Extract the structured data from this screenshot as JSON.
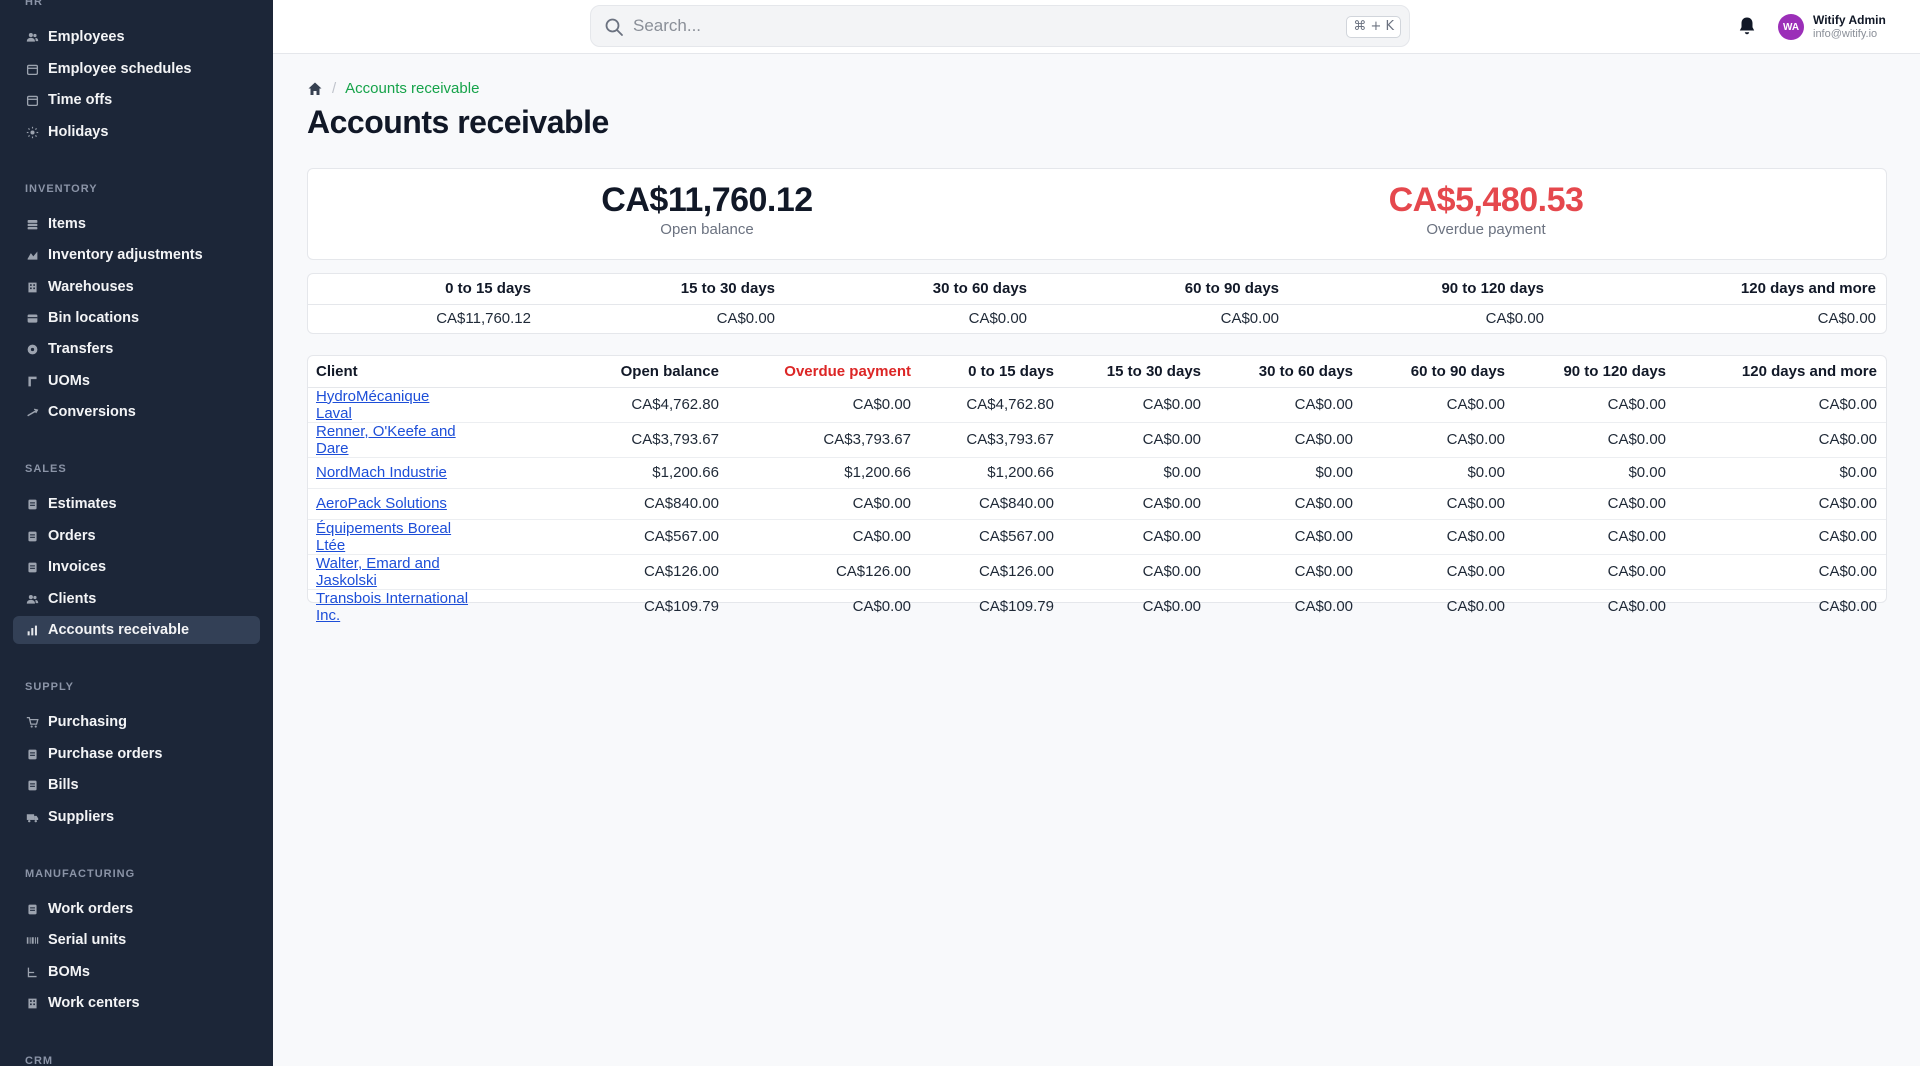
{
  "sidebar": {
    "sections": [
      {
        "title": "HR",
        "items": [
          {
            "label": "Employees",
            "icon": "people-icon"
          },
          {
            "label": "Employee schedules",
            "icon": "calendar-icon"
          },
          {
            "label": "Time offs",
            "icon": "calendar-icon"
          },
          {
            "label": "Holidays",
            "icon": "sun-icon"
          }
        ]
      },
      {
        "title": "INVENTORY",
        "items": [
          {
            "label": "Items",
            "icon": "stack-icon"
          },
          {
            "label": "Inventory adjustments",
            "icon": "scale-icon"
          },
          {
            "label": "Warehouses",
            "icon": "building-icon"
          },
          {
            "label": "Bin locations",
            "icon": "box-icon"
          },
          {
            "label": "Transfers",
            "icon": "transfer-icon"
          },
          {
            "label": "UOMs",
            "icon": "ruler-icon"
          },
          {
            "label": "Conversions",
            "icon": "conversion-icon"
          }
        ]
      },
      {
        "title": "SALES",
        "items": [
          {
            "label": "Estimates",
            "icon": "document-icon"
          },
          {
            "label": "Orders",
            "icon": "document-icon"
          },
          {
            "label": "Invoices",
            "icon": "document-icon"
          },
          {
            "label": "Clients",
            "icon": "people-icon"
          },
          {
            "label": "Accounts receivable",
            "icon": "bar-chart-icon"
          }
        ]
      },
      {
        "title": "SUPPLY",
        "items": [
          {
            "label": "Purchasing",
            "icon": "cart-icon"
          },
          {
            "label": "Purchase orders",
            "icon": "document-icon"
          },
          {
            "label": "Bills",
            "icon": "document-icon"
          },
          {
            "label": "Suppliers",
            "icon": "truck-icon"
          }
        ]
      },
      {
        "title": "MANUFACTURING",
        "items": [
          {
            "label": "Work orders",
            "icon": "document-icon"
          },
          {
            "label": "Serial units",
            "icon": "barcode-icon"
          },
          {
            "label": "BOMs",
            "icon": "tree-icon"
          },
          {
            "label": "Work centers",
            "icon": "building-icon"
          }
        ]
      },
      {
        "title": "CRM",
        "items": []
      }
    ],
    "active_item": "Accounts receivable"
  },
  "topbar": {
    "search_placeholder": "Search...",
    "shortcut": "⌘ + K",
    "user": {
      "initials": "WA",
      "name": "Witify Admin",
      "email": "info@witify.io",
      "avatar_color": "#9b2fb8"
    }
  },
  "breadcrumb": {
    "current": "Accounts receivable"
  },
  "page_title": "Accounts receivable",
  "summary": {
    "open_balance": {
      "value": "CA$11,760.12",
      "label": "Open balance"
    },
    "overdue_payment": {
      "value": "CA$5,480.53",
      "label": "Overdue payment",
      "color": "#e5484d"
    }
  },
  "aging": {
    "headers": [
      "0 to 15 days",
      "15 to 30 days",
      "30 to 60 days",
      "60 to 90 days",
      "90 to 120 days",
      "120 days and more"
    ],
    "values": [
      "CA$11,760.12",
      "CA$0.00",
      "CA$0.00",
      "CA$0.00",
      "CA$0.00",
      "CA$0.00"
    ]
  },
  "clients_table": {
    "headers": [
      "Client",
      "Open balance",
      "Overdue payment",
      "0 to 15 days",
      "15 to 30 days",
      "30 to 60 days",
      "60 to 90 days",
      "90 to 120 days",
      "120 days and more"
    ],
    "rows": [
      [
        "HydroMécanique Laval",
        "CA$4,762.80",
        "CA$0.00",
        "CA$4,762.80",
        "CA$0.00",
        "CA$0.00",
        "CA$0.00",
        "CA$0.00",
        "CA$0.00"
      ],
      [
        "Renner, O'Keefe and Dare",
        "CA$3,793.67",
        "CA$3,793.67",
        "CA$3,793.67",
        "CA$0.00",
        "CA$0.00",
        "CA$0.00",
        "CA$0.00",
        "CA$0.00"
      ],
      [
        "NordMach Industrie",
        "$1,200.66",
        "$1,200.66",
        "$1,200.66",
        "$0.00",
        "$0.00",
        "$0.00",
        "$0.00",
        "$0.00"
      ],
      [
        "AeroPack Solutions",
        "CA$840.00",
        "CA$0.00",
        "CA$840.00",
        "CA$0.00",
        "CA$0.00",
        "CA$0.00",
        "CA$0.00",
        "CA$0.00"
      ],
      [
        "Équipements Boreal Ltée",
        "CA$567.00",
        "CA$0.00",
        "CA$567.00",
        "CA$0.00",
        "CA$0.00",
        "CA$0.00",
        "CA$0.00",
        "CA$0.00"
      ],
      [
        "Walter, Emard and Jaskolski",
        "CA$126.00",
        "CA$126.00",
        "CA$126.00",
        "CA$0.00",
        "CA$0.00",
        "CA$0.00",
        "CA$0.00",
        "CA$0.00"
      ],
      [
        "Transbois International Inc.",
        "CA$109.79",
        "CA$0.00",
        "CA$109.79",
        "CA$0.00",
        "CA$0.00",
        "CA$0.00",
        "CA$0.00",
        "CA$0.00"
      ]
    ]
  }
}
